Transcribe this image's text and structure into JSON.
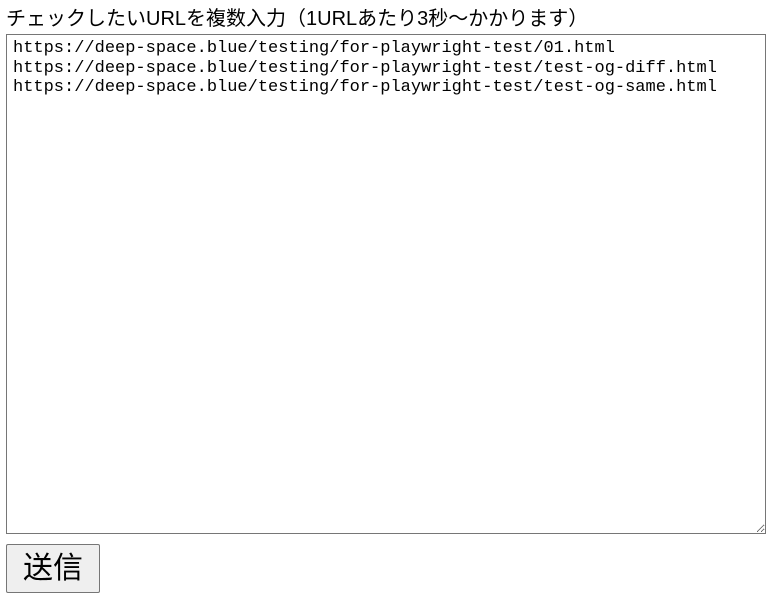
{
  "form": {
    "label": "チェックしたいURLを複数入力（1URLあたり3秒〜かかります）",
    "textarea_value": "https://deep-space.blue/testing/for-playwright-test/01.html\nhttps://deep-space.blue/testing/for-playwright-test/test-og-diff.html\nhttps://deep-space.blue/testing/for-playwright-test/test-og-same.html",
    "submit_label": "送信"
  }
}
